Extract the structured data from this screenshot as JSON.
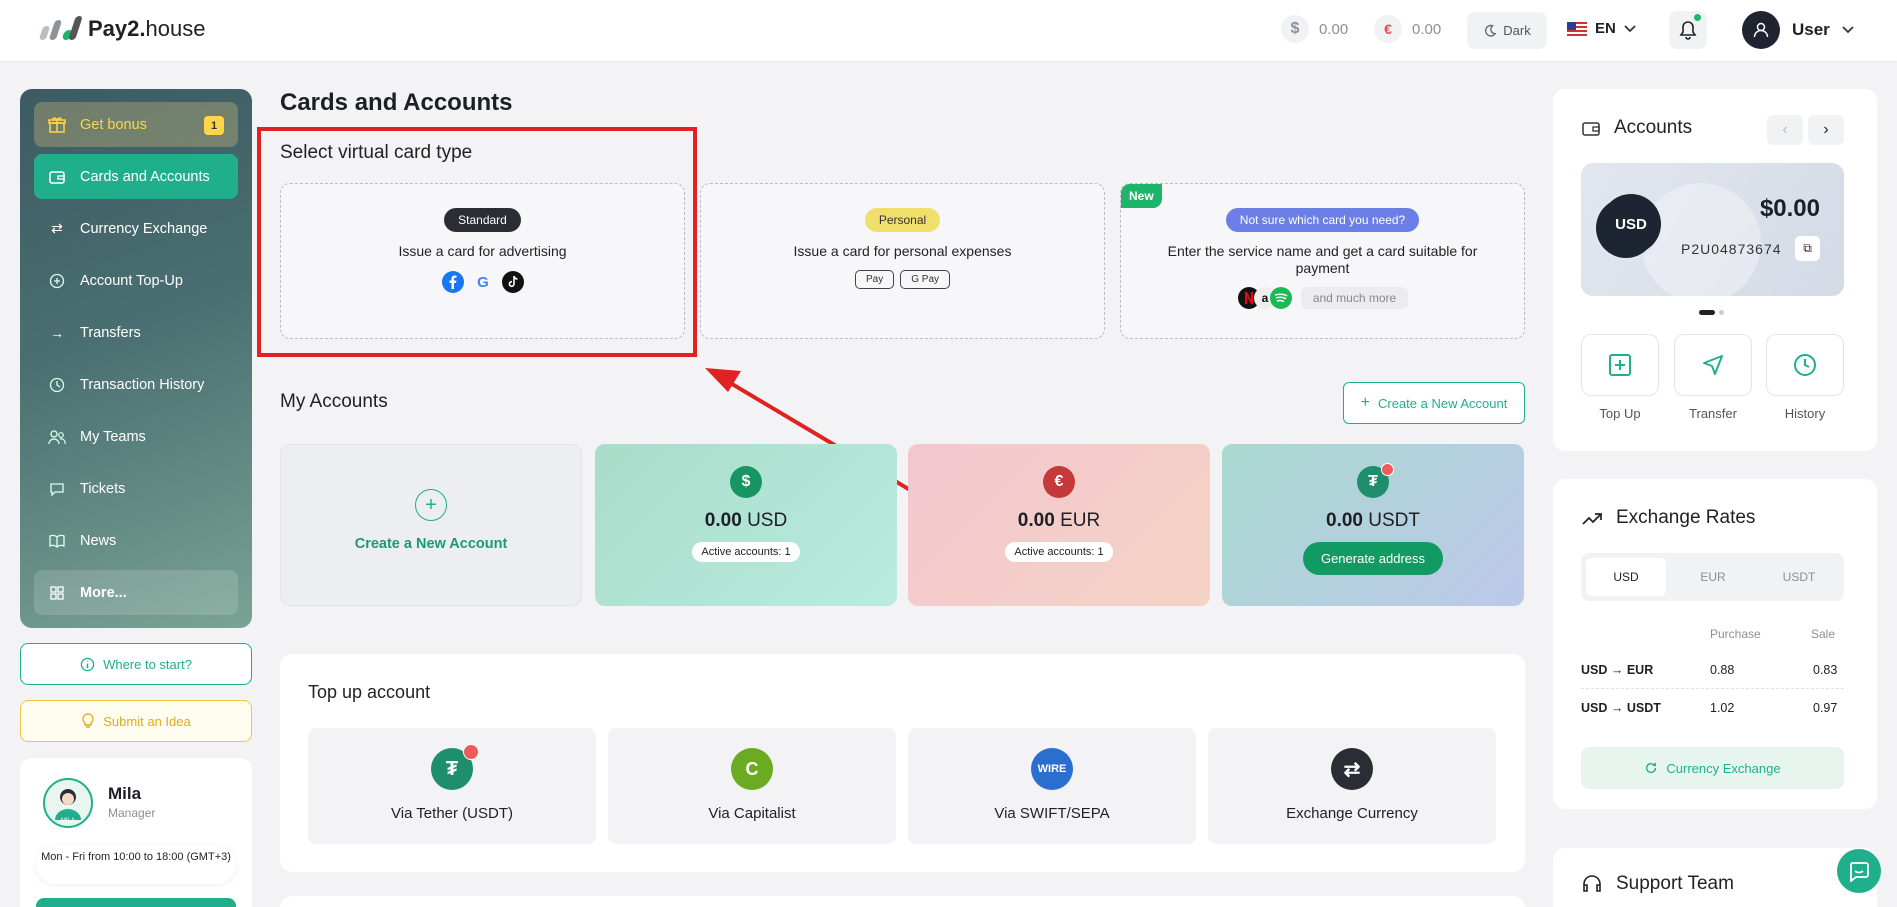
{
  "header": {
    "logo_bold": "Pay2.",
    "logo_light": "house",
    "balance_usd_symbol": "$",
    "balance_usd": "0.00",
    "balance_eur_symbol": "€",
    "balance_eur": "0.00",
    "theme_label": "Dark",
    "language": "EN",
    "user_name": "User"
  },
  "sidebar": {
    "bonus_label": "Get bonus",
    "bonus_count": "1",
    "items": [
      {
        "label": "Cards and Accounts",
        "icon": "wallet-icon"
      },
      {
        "label": "Currency Exchange",
        "icon": "exchange-icon"
      },
      {
        "label": "Account Top-Up",
        "icon": "plus-circle-icon"
      },
      {
        "label": "Transfers",
        "icon": "arrow-right-icon"
      },
      {
        "label": "Transaction History",
        "icon": "clock-icon"
      },
      {
        "label": "My Teams",
        "icon": "users-icon"
      },
      {
        "label": "Tickets",
        "icon": "chat-icon"
      },
      {
        "label": "News",
        "icon": "book-icon"
      },
      {
        "label": "More...",
        "icon": "grid-icon"
      }
    ],
    "where_to_start": "Where to start?",
    "submit_idea": "Submit an Idea",
    "manager": {
      "name": "Mila",
      "role": "Manager",
      "avatar_caption": "MILA",
      "hours": "Mon - Fri from 10:00 to 18:00 (GMT+3)"
    }
  },
  "main": {
    "title": "Cards and Accounts",
    "card_section_title": "Select virtual card type",
    "card_types": [
      {
        "badge": "Standard",
        "text": "Issue a card for advertising"
      },
      {
        "badge": "Personal",
        "text": "Issue a card for personal expenses",
        "pay_badges": [
          " Pay",
          "G Pay"
        ]
      },
      {
        "tag": "New",
        "badge": "Not sure which card you need?",
        "text": "Enter the service name and get a card suitable for payment",
        "more": "and much more"
      }
    ],
    "accounts_title": "My Accounts",
    "create_account_button": "Create a New Account",
    "create_account_tile": "Create a New Account",
    "accounts": [
      {
        "symbol": "$",
        "amount": "0.00",
        "currency": "USD",
        "note": "Active accounts: 1",
        "color": "#179563"
      },
      {
        "symbol": "€",
        "amount": "0.00",
        "currency": "EUR",
        "note": "Active accounts: 1",
        "color": "#c43a3a"
      },
      {
        "symbol": "₮",
        "amount": "0.00",
        "currency": "USDT",
        "action": "Generate address",
        "color": "#1e8f6a"
      }
    ],
    "topup_title": "Top up account",
    "topup_methods": [
      {
        "label": "Via Tether (USDT)",
        "icon_text": "₮",
        "color": "#1e8f6a"
      },
      {
        "label": "Via Capitalist",
        "icon_text": "C",
        "color": "#6aab22"
      },
      {
        "label": "Via SWIFT/SEPA",
        "icon_text": "WIRE",
        "color": "#2a6fd0"
      },
      {
        "label": "Exchange Currency",
        "icon_text": "⇄",
        "color": "#2a2d33"
      }
    ]
  },
  "right": {
    "accounts_title": "Accounts",
    "card_currency": "USD",
    "card_balance": "$0.00",
    "card_number": "P2U04873674",
    "actions": [
      "Top Up",
      "Transfer",
      "History"
    ],
    "rates_title": "Exchange Rates",
    "rate_tabs": [
      "USD",
      "EUR",
      "USDT"
    ],
    "rate_headers": [
      "Purchase",
      "Sale"
    ],
    "rates": [
      {
        "pair": "USD → EUR",
        "purchase": "0.88",
        "sale": "0.83"
      },
      {
        "pair": "USD → USDT",
        "purchase": "1.02",
        "sale": "0.97"
      }
    ],
    "exchange_button": "Currency Exchange",
    "support_title": "Support Team"
  },
  "colors": {
    "accent": "#1fb08b",
    "annotation": "#e02222"
  }
}
